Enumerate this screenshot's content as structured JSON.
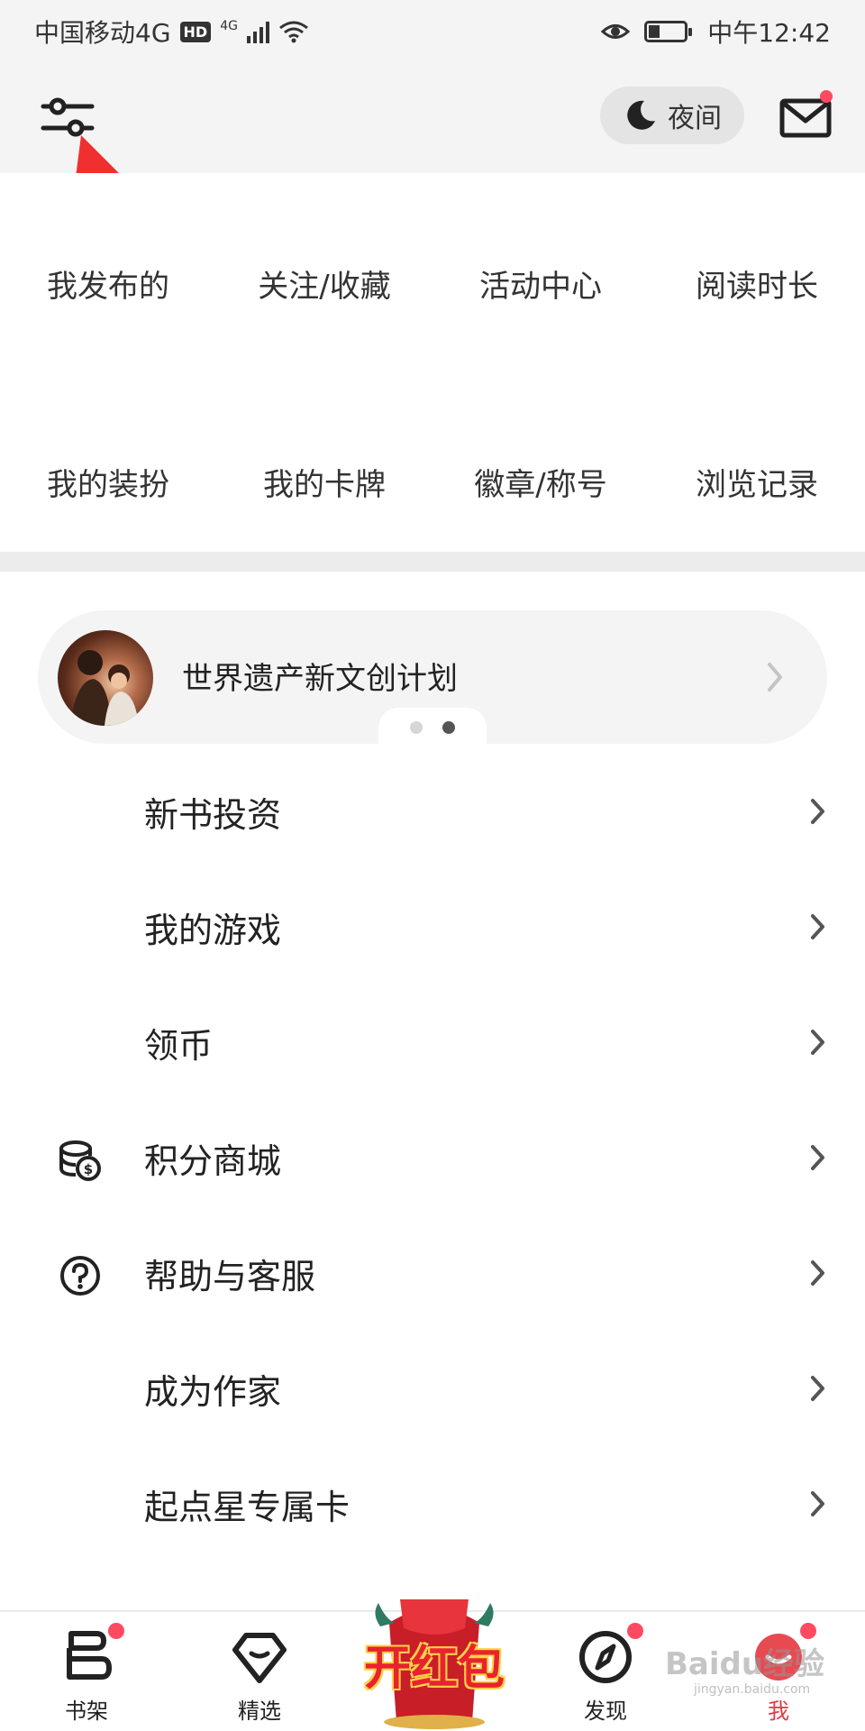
{
  "status_bar": {
    "carrier": "中国移动4G",
    "hd": "HD",
    "network": "4G",
    "time": "中午12:42"
  },
  "header": {
    "night_label": "夜间"
  },
  "grid": {
    "row1": [
      "我发布的",
      "关注/收藏",
      "活动中心",
      "阅读时长"
    ],
    "row2": [
      "我的装扮",
      "我的卡牌",
      "徽章/称号",
      "浏览记录"
    ]
  },
  "banner": {
    "title": "世界遗产新文创计划",
    "page_count": 2,
    "active_page": 2
  },
  "list": [
    {
      "label": "新书投资",
      "icon": ""
    },
    {
      "label": "我的游戏",
      "icon": ""
    },
    {
      "label": "领币",
      "icon": ""
    },
    {
      "label": "积分商城",
      "icon": "coins-icon"
    },
    {
      "label": "帮助与客服",
      "icon": "help-circle-icon"
    },
    {
      "label": "成为作家",
      "icon": ""
    },
    {
      "label": "起点星专属卡",
      "icon": ""
    }
  ],
  "bottom_nav": {
    "bookshelf": "书架",
    "featured": "精选",
    "redpacket": "开红包",
    "discover": "发现",
    "me": "我"
  },
  "watermark": {
    "text": "Baidu经验",
    "sub": "jingyan.baidu.com"
  },
  "colors": {
    "accent": "#e03a45",
    "badge": "#ff4a62",
    "header_bg": "#f4f4f4"
  }
}
